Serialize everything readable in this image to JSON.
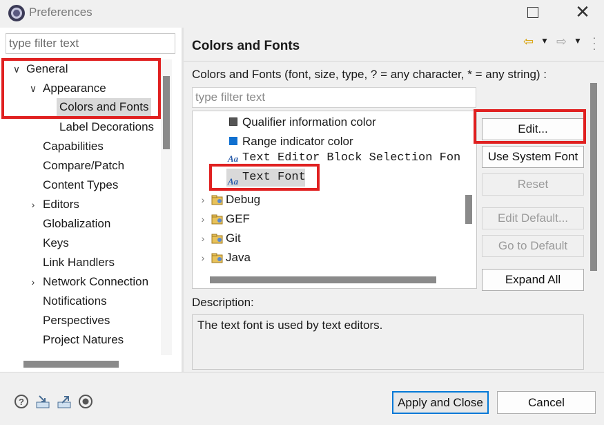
{
  "window": {
    "title": "Preferences"
  },
  "left": {
    "filter_placeholder": "type filter text",
    "tree": [
      {
        "label": "General",
        "expanded": true
      },
      {
        "label": "Appearance",
        "expanded": true
      },
      {
        "label": "Colors and Fonts",
        "selected": true
      },
      {
        "label": "Label Decorations"
      },
      {
        "label": "Capabilities"
      },
      {
        "label": "Compare/Patch"
      },
      {
        "label": "Content Types"
      },
      {
        "label": "Editors",
        "expandable": true
      },
      {
        "label": "Globalization"
      },
      {
        "label": "Keys"
      },
      {
        "label": "Link Handlers"
      },
      {
        "label": "Network Connection",
        "expandable": true
      },
      {
        "label": "Notifications"
      },
      {
        "label": "Perspectives"
      },
      {
        "label": "Project Natures"
      }
    ]
  },
  "right": {
    "title": "Colors and Fonts",
    "filter_hint": "Colors and Fonts (font, size, type, ? = any character, * = any string) :",
    "filter_placeholder": "type filter text",
    "items": [
      {
        "label": "Qualifier information color",
        "kind": "color",
        "color": "#555555"
      },
      {
        "label": "Range indicator color",
        "kind": "color",
        "color": "#1070d0"
      },
      {
        "label": "Text Editor Block Selection Font",
        "kind": "font"
      },
      {
        "label": "Text Font",
        "kind": "font",
        "selected": true
      },
      {
        "label": "Debug",
        "kind": "category"
      },
      {
        "label": "GEF",
        "kind": "category"
      },
      {
        "label": "Git",
        "kind": "category"
      },
      {
        "label": "Java",
        "kind": "category"
      }
    ],
    "buttons": {
      "edit": "Edit...",
      "use_system_font": "Use System Font",
      "reset": "Reset",
      "edit_default": "Edit Default...",
      "go_to_default": "Go to Default",
      "expand_all": "Expand All"
    },
    "description_label": "Description:",
    "description_text": "The text font is used by text editors."
  },
  "footer": {
    "apply_close": "Apply and Close",
    "cancel": "Cancel"
  },
  "colors": {
    "accent": "#0078d7",
    "annotation": "#e02020",
    "selection": "#d9d9d9"
  }
}
